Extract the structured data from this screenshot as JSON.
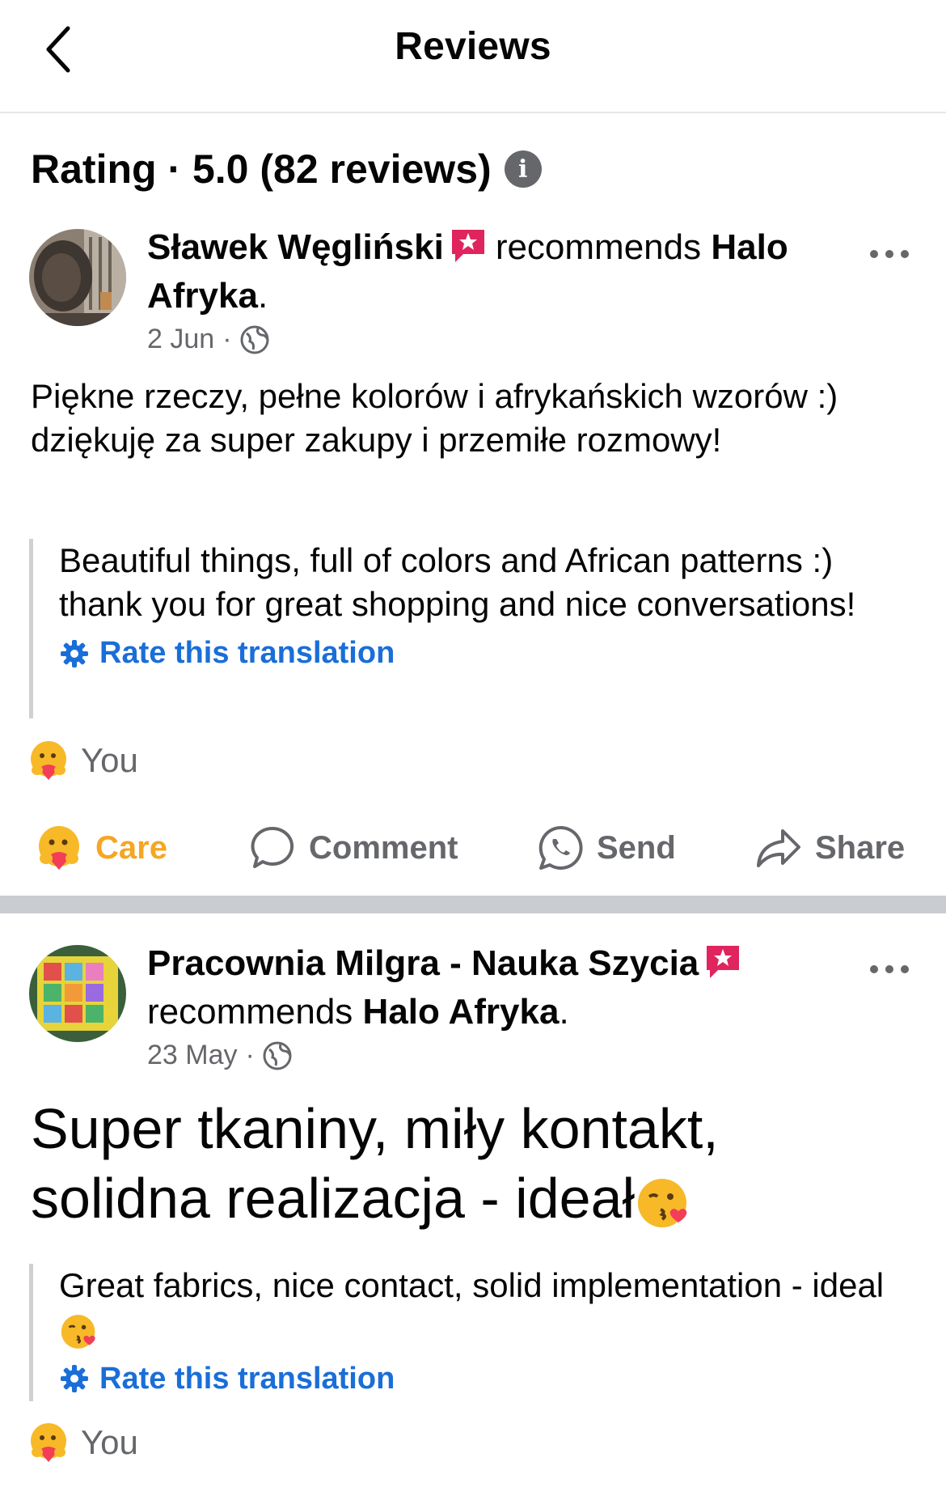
{
  "header": {
    "title": "Reviews"
  },
  "rating": {
    "text": "Rating · 5.0 (82 reviews)"
  },
  "reviews": [
    {
      "author": "Sławek Węgliński",
      "verb": "recommends",
      "page": "Halo Afryka",
      "date": "2 Jun",
      "text": "Piękne rzeczy, pełne kolorów i afrykańskich wzorów :) dziękuję za super zakupy i przemiłe rozmowy!",
      "translation": "Beautiful things, full of colors and African patterns :) thank you for great shopping and nice conversations!",
      "rate_label": "Rate this translation",
      "reaction_by": "You"
    },
    {
      "author": "Pracownia Milgra - Nauka Szycia",
      "verb": "recommends",
      "page": "Halo Afryka",
      "date": "23 May",
      "text": "Super tkaniny, miły kontakt, solidna realizacja - ideał",
      "translation": "Great fabrics, nice contact, solid implementation - ideal",
      "rate_label": "Rate this translation",
      "reaction_by": "You"
    }
  ],
  "actions": {
    "care": "Care",
    "comment": "Comment",
    "send": "Send",
    "share": "Share"
  },
  "colors": {
    "link": "#1a6ed8",
    "care": "#f5a623",
    "muted": "#65676b",
    "badge": "#e0245e"
  }
}
